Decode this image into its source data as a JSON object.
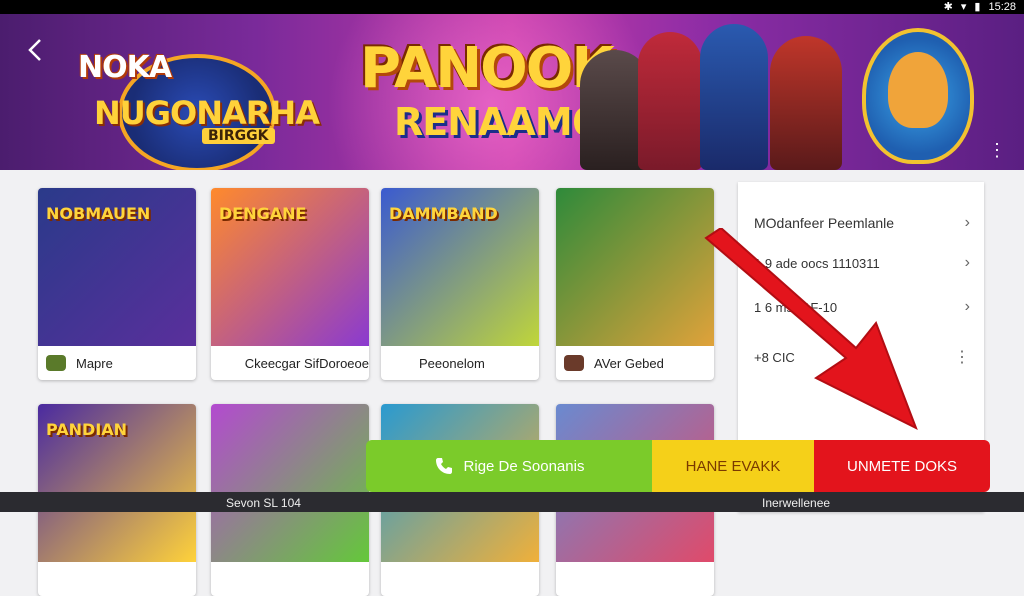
{
  "status_bar": {
    "time": "15:28",
    "icons": [
      "bluetooth-icon",
      "wifi-icon",
      "signal-icon",
      "battery-icon"
    ]
  },
  "banner": {
    "back_icon": "chevron-left-icon",
    "logo_line1": "NOKA",
    "logo_line2": "NUGONARHA",
    "logo_tag": "BIRGGK",
    "title_line1": "PANOOK",
    "title_line2": "RENAAM6",
    "more_icon": "kebab-icon"
  },
  "grid": {
    "cards": [
      {
        "art_title": "NOBMAUEN",
        "label": "Mapre",
        "colors": [
          "#2a3a8a",
          "#5a2f9c"
        ],
        "icon_color": "#5a7a2a"
      },
      {
        "art_title": "DENGANE",
        "label": "Ckeecgar SifDoroeoe",
        "colors": [
          "#ff8a2c",
          "#8a3ad0"
        ],
        "icon_color": "#ffffff"
      },
      {
        "art_title": "DAMMBAND",
        "label": "Peeonelom",
        "colors": [
          "#3a5ad0",
          "#c0d63a"
        ],
        "icon_color": "#ffffff"
      },
      {
        "art_title": "",
        "label": "AVer Gebed",
        "colors": [
          "#2e8a3a",
          "#e0a23a"
        ],
        "icon_color": "#6a3a2a"
      },
      {
        "art_title": "PANDIAN",
        "label": "",
        "colors": [
          "#4a2aa0",
          "#ffd23a"
        ],
        "icon_color": "#ffffff"
      },
      {
        "art_title": "",
        "label": "",
        "colors": [
          "#b34ad0",
          "#64c83a"
        ],
        "icon_color": "#ffffff"
      },
      {
        "art_title": "",
        "label": "",
        "colors": [
          "#2a9ad0",
          "#f0b03a"
        ],
        "icon_color": "#ffffff"
      },
      {
        "art_title": "",
        "label": "",
        "colors": [
          "#6a8ad0",
          "#e04a6a"
        ],
        "icon_color": "#ffffff"
      }
    ]
  },
  "side_panel": {
    "rows": [
      {
        "text": "MOdanfeer Peemlanle",
        "chevron": "›"
      },
      {
        "text": "1 9 ade oocs 1110311",
        "chevron": "›"
      },
      {
        "text": "1 6 mss 1F-10",
        "chevron": "›"
      },
      {
        "text": "+8 CIC",
        "chevron": "⋮"
      }
    ]
  },
  "action_bar": {
    "call_label": "Rige De Soonanis",
    "middle_label": "HANE EVAKK",
    "right_label": "UNMETE DOKS"
  },
  "bottom_strip": {
    "left_text": "Sevon SL 104",
    "right_text": "Inerwellenee"
  },
  "colors": {
    "banner_start": "#4b1d6e",
    "banner_mid": "#c23aa8",
    "accent_green": "#7bcb2a",
    "accent_yellow": "#f5d019",
    "accent_red": "#e3141c"
  }
}
